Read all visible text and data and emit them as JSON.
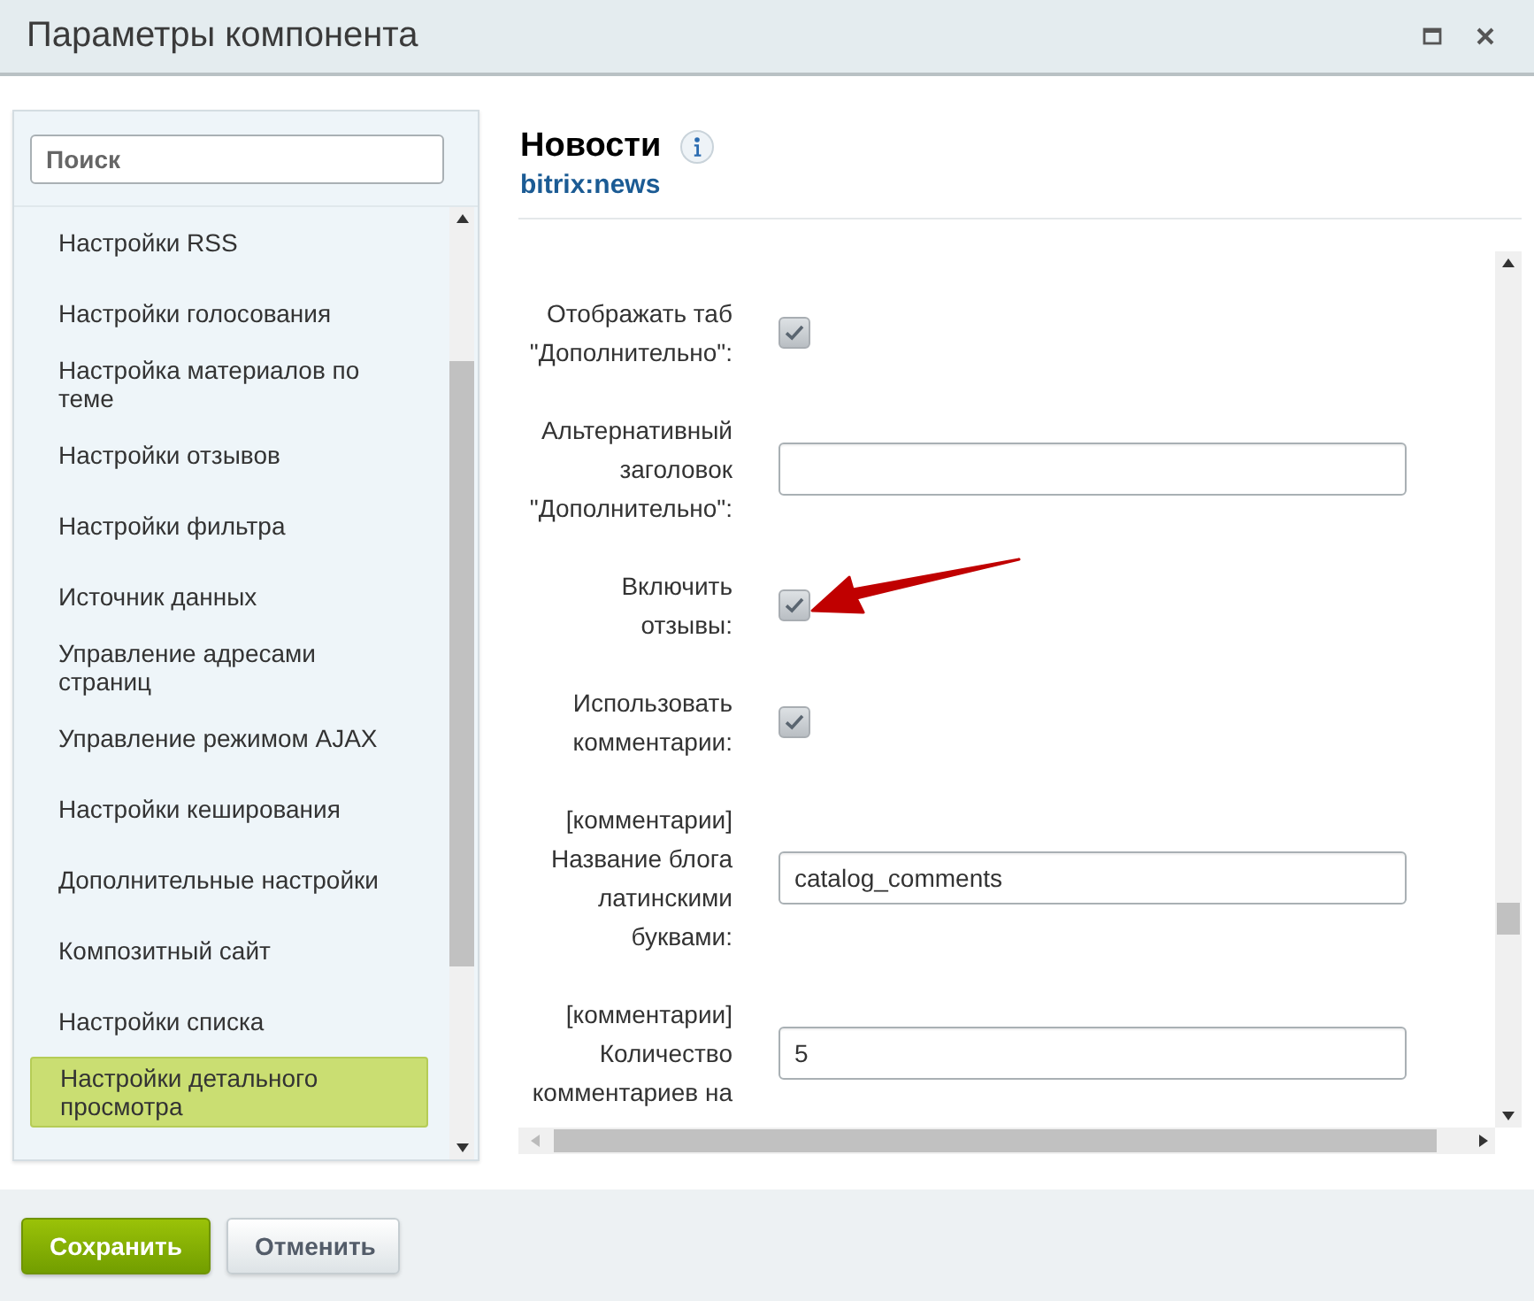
{
  "window": {
    "title": "Параметры компонента"
  },
  "sidebar": {
    "search": {
      "placeholder": "Поиск"
    },
    "items": [
      {
        "label": "Настройки RSS",
        "selected": false
      },
      {
        "label": "Настройки голосования",
        "selected": false
      },
      {
        "label": "Настройка материалов по теме",
        "selected": false
      },
      {
        "label": "Настройки отзывов",
        "selected": false
      },
      {
        "label": "Настройки фильтра",
        "selected": false
      },
      {
        "label": "Источник данных",
        "selected": false
      },
      {
        "label": "Управление адресами страниц",
        "selected": false
      },
      {
        "label": "Управление режимом AJAX",
        "selected": false
      },
      {
        "label": "Настройки кеширования",
        "selected": false
      },
      {
        "label": "Дополнительные настройки",
        "selected": false
      },
      {
        "label": "Композитный сайт",
        "selected": false
      },
      {
        "label": "Настройки списка",
        "selected": false
      },
      {
        "label": "Настройки детального просмотра",
        "selected": true
      }
    ]
  },
  "component": {
    "name": "Новости",
    "code": "bitrix:news"
  },
  "fields": [
    {
      "kind": "checkbox",
      "label": "Отображать таб\n\"Дополнительно\":",
      "checked": true
    },
    {
      "kind": "text",
      "label": "Альтернативный\nзаголовок\n\"Дополнительно\":"
    },
    {
      "kind": "checkbox",
      "label": "Включить\nотзывы:",
      "checked": true,
      "pointer": true
    },
    {
      "kind": "checkbox",
      "label": "Использовать\nкомментарии:",
      "checked": true
    },
    {
      "kind": "text",
      "label": "[комментарии]\nНазвание блога\nлатинскими\nбуквами:",
      "value": "catalog_comments"
    },
    {
      "kind": "text",
      "label": "[комментарии]\nКоличество\nкомментариев на",
      "value": "5"
    }
  ],
  "buttons": [
    {
      "kind": "primary",
      "label": "Сохранить"
    },
    {
      "kind": "secondary",
      "label": "Отменить"
    }
  ]
}
